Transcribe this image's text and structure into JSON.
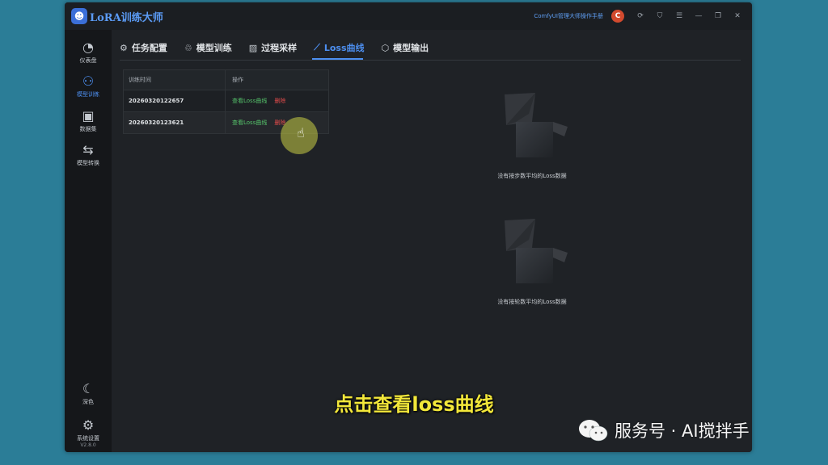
{
  "app": {
    "logo_text": "LoRA训练大师",
    "manual_link": "ComfyUI管理大师操作手册"
  },
  "sidebar": {
    "items": [
      {
        "label": "仪表盘",
        "icon": "dashboard-gauge-icon"
      },
      {
        "label": "模型训练",
        "icon": "model-train-icon"
      },
      {
        "label": "数据集",
        "icon": "image-dataset-icon"
      },
      {
        "label": "模型转换",
        "icon": "convert-icon"
      }
    ],
    "bottom": [
      {
        "label": "深色",
        "icon": "moon-icon"
      },
      {
        "label": "系统设置",
        "icon": "gear-icon"
      }
    ],
    "version": "V2.8.0"
  },
  "tabs": [
    {
      "label": "任务配置",
      "icon": "gear-icon"
    },
    {
      "label": "模型训练",
      "icon": "recycle-icon"
    },
    {
      "label": "过程采样",
      "icon": "image-icon"
    },
    {
      "label": "Loss曲线",
      "icon": "line-chart-icon",
      "active": true
    },
    {
      "label": "模型输出",
      "icon": "box-icon"
    }
  ],
  "table": {
    "headers": [
      "训练时间",
      "操作"
    ],
    "rows": [
      {
        "time": "20260320122657",
        "view": "查看Loss曲线",
        "delete": "删除"
      },
      {
        "time": "20260320123621",
        "view": "查看Loss曲线",
        "delete": "删除"
      }
    ]
  },
  "empty_states": [
    {
      "text": "没有按步数平均的Loss数据"
    },
    {
      "text": "没有按轮数平均的Loss数据"
    }
  ],
  "overlay": {
    "subtitle": "点击查看loss曲线",
    "watermark": "服务号 · AI搅拌手"
  },
  "colors": {
    "accent": "#4d8ff0",
    "view_link": "#55c26a",
    "delete_link": "#e24b4b",
    "subtitle": "#f2e73a"
  }
}
